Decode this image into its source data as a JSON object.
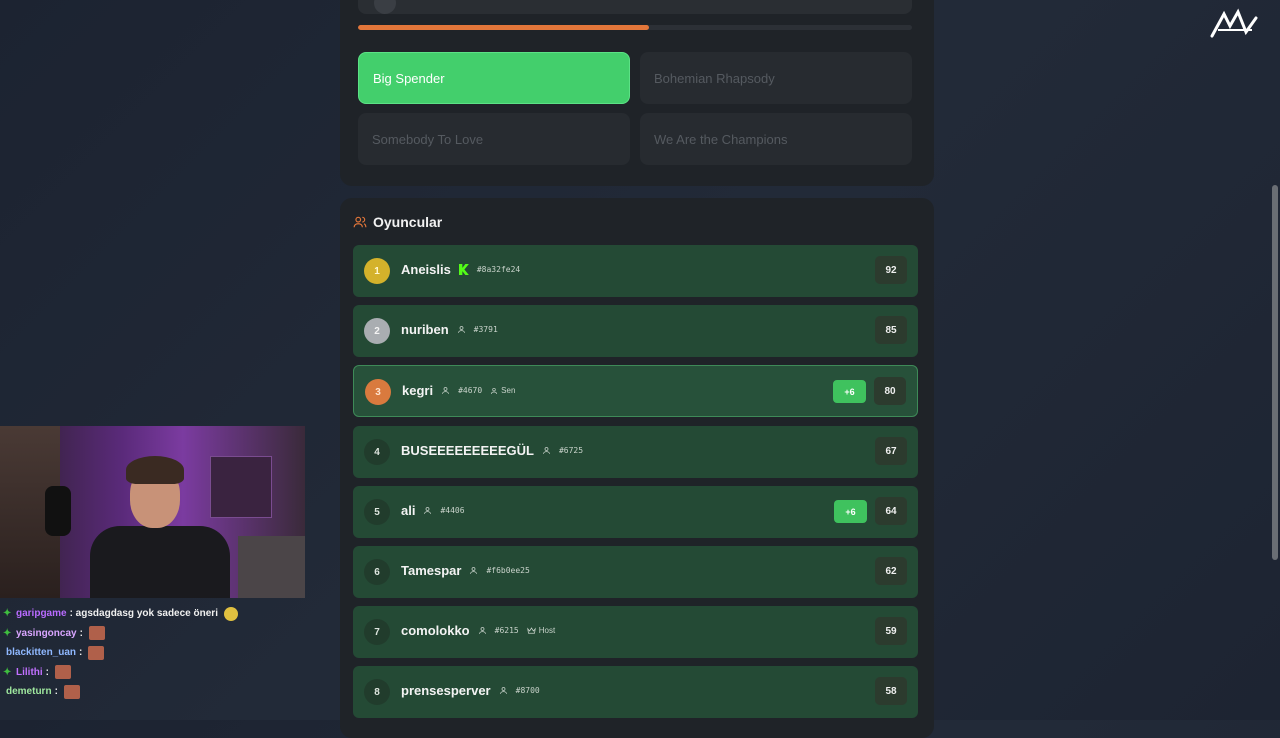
{
  "question": {
    "progress_percent": 52.5,
    "answers": [
      {
        "label": "Big Spender",
        "selected": true
      },
      {
        "label": "Bohemian Rhapsody",
        "selected": false
      },
      {
        "label": "Somebody To Love",
        "selected": false
      },
      {
        "label": "We Are the Champions",
        "selected": false
      }
    ]
  },
  "players": {
    "title": "Oyuncular",
    "rows": [
      {
        "rank": "1",
        "name": "Aneislis",
        "tag": "#8a32fe24",
        "extra": "",
        "gain": "",
        "score": "92",
        "icon": "kick-icon"
      },
      {
        "rank": "2",
        "name": "nuriben",
        "tag": "#3791",
        "extra": "",
        "gain": "",
        "score": "85",
        "icon": "user-icon"
      },
      {
        "rank": "3",
        "name": "kegri",
        "tag": "#4670",
        "extra": "Sen",
        "gain": "+6",
        "score": "80",
        "icon": "user-icon"
      },
      {
        "rank": "4",
        "name": "BUSEEEEEEEEEGÜL",
        "tag": "#6725",
        "extra": "",
        "gain": "",
        "score": "67",
        "icon": "user-icon"
      },
      {
        "rank": "5",
        "name": "ali",
        "tag": "#4406",
        "extra": "",
        "gain": "+6",
        "score": "64",
        "icon": "user-icon"
      },
      {
        "rank": "6",
        "name": "Tamespar",
        "tag": "#f6b0ee25",
        "extra": "",
        "gain": "",
        "score": "62",
        "icon": "user-icon"
      },
      {
        "rank": "7",
        "name": "comolokko",
        "tag": "#6215",
        "extra": "Host",
        "gain": "",
        "score": "59",
        "icon": "user-icon"
      },
      {
        "rank": "8",
        "name": "prensesperver",
        "tag": "#8700",
        "extra": "",
        "gain": "",
        "score": "58",
        "icon": "user-icon"
      }
    ]
  },
  "chat": [
    {
      "user": "garipgame",
      "text": ": agsdagdasg yok sadece öneri",
      "color": "#b86bff",
      "badge": true,
      "emote": "face"
    },
    {
      "user": "yasingoncay",
      "text": ":",
      "color": "#d9a5ff",
      "badge": true,
      "emote": "img"
    },
    {
      "user": "blackitten_uan",
      "text": ":",
      "color": "#8fb8ff",
      "badge": false,
      "emote": "img"
    },
    {
      "user": "Lilithi",
      "text": ":",
      "color": "#c070ff",
      "badge": true,
      "emote": "img"
    },
    {
      "user": "demeturn",
      "text": ":",
      "color": "#9fe89f",
      "badge": false,
      "emote": "img"
    }
  ],
  "colors": {
    "accent_green": "#43cf6c",
    "progress_orange": "#e2763a",
    "row_green": "#244a35",
    "gold": "#d4b22b",
    "silver": "#a9adb1",
    "bronze": "#d97a3e"
  }
}
